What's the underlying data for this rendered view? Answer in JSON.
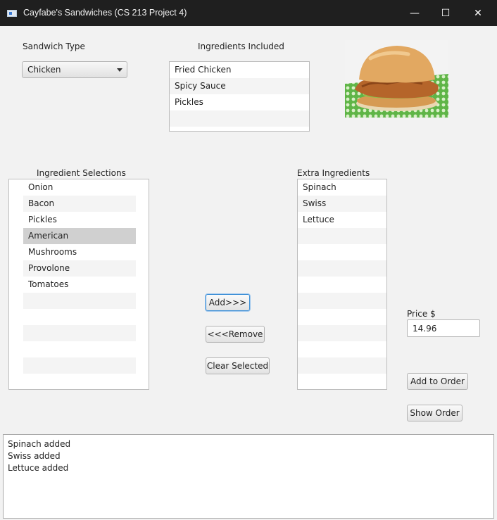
{
  "window": {
    "title": "Cayfabe's Sandwiches (CS 213 Project 4)",
    "minimize": "—",
    "maximize": "☐",
    "close": "✕"
  },
  "sandwich_type": {
    "label": "Sandwich Type",
    "selected": "Chicken"
  },
  "ingredients_included": {
    "label": "Ingredients Included",
    "items": [
      "Fried Chicken",
      "Spicy Sauce",
      "Pickles"
    ]
  },
  "ingredient_selections": {
    "label": "Ingredient Selections",
    "items": [
      "Onion",
      "Bacon",
      "Pickles",
      "American",
      "Mushrooms",
      "Provolone",
      "Tomatoes"
    ],
    "selected_index": 3
  },
  "extra_ingredients": {
    "label": "Extra Ingredients",
    "items": [
      "Spinach",
      "Swiss",
      "Lettuce"
    ]
  },
  "buttons": {
    "add": "Add>>>",
    "remove": "<<<Remove",
    "clear": "Clear Selected",
    "add_to_order": "Add to Order",
    "show_order": "Show Order"
  },
  "price": {
    "label": "Price $",
    "value": "14.96"
  },
  "output_log": [
    "Spinach added",
    "Swiss added",
    "Lettuce added"
  ],
  "icons": {
    "app": "app-window-icon",
    "image": "chicken-sandwich-image"
  }
}
